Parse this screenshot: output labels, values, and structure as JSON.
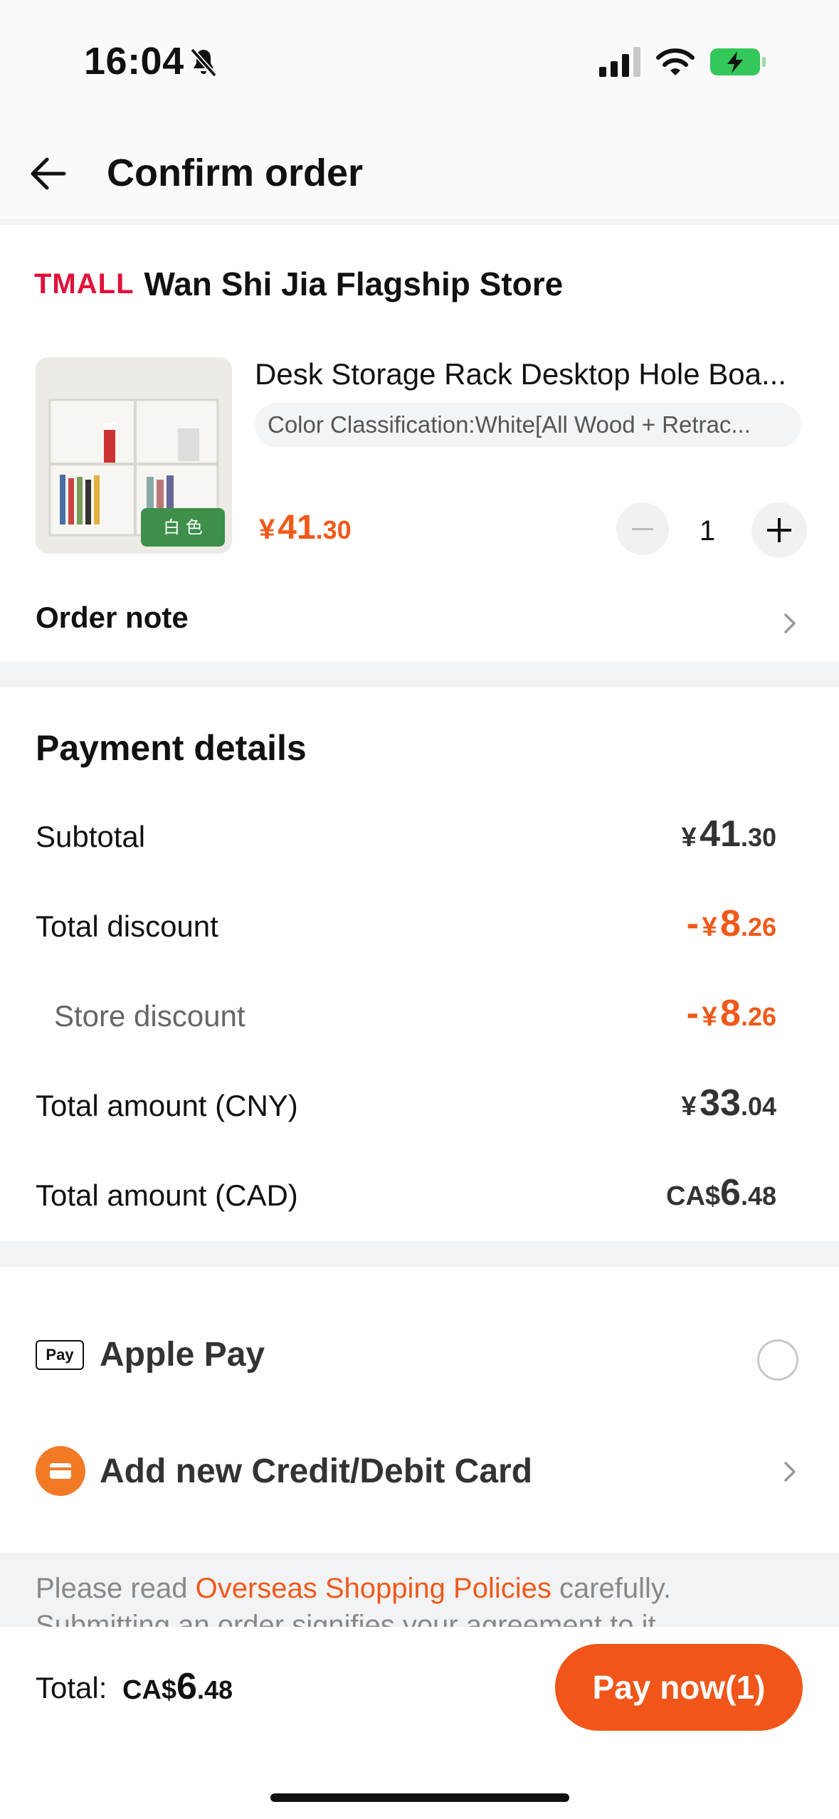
{
  "status_bar": {
    "time": "16:04",
    "icons": [
      "bell-slash-icon",
      "cellular-signal-icon",
      "wifi-icon",
      "battery-charging-icon"
    ]
  },
  "header": {
    "title": "Confirm order",
    "back_icon": "arrow-left-icon"
  },
  "store": {
    "logo_text": "TMALL",
    "name": "Wan Shi Jia Flagship Store",
    "product": {
      "title": "Desk Storage Rack Desktop Hole Boa...",
      "sku": "Color Classification:White[All Wood + Retrac...",
      "image_badge": "白 色",
      "price_symbol": "¥",
      "price_int": "41",
      "price_dec": ".30",
      "quantity": "1"
    },
    "note_label": "Order note"
  },
  "payment_details": {
    "title": "Payment details",
    "subtotal_label": "Subtotal",
    "subtotal_sym": "¥",
    "subtotal_int": "41",
    "subtotal_dec": ".30",
    "discount_label": "Total discount",
    "discount_sign": "-",
    "discount_sym": "¥",
    "discount_int": "8",
    "discount_dec": ".26",
    "store_discount_label": "Store discount",
    "store_discount_sign": "-",
    "store_discount_sym": "¥",
    "store_discount_int": "8",
    "store_discount_dec": ".26",
    "cny_label": "Total amount (CNY)",
    "cny_sym": "¥",
    "cny_int": "33",
    "cny_dec": ".04",
    "cad_label": "Total amount (CAD)",
    "cad_sym": "CA$",
    "cad_int": "6",
    "cad_dec": ".48"
  },
  "payment_methods": {
    "applepay_mark": "Pay",
    "applepay_label": "Apple Pay",
    "add_card_label": "Add new Credit/Debit Card"
  },
  "notice": {
    "prefix": "Please read ",
    "link": "Overseas Shopping Policies",
    "suffix": " carefully.",
    "line2": "Submitting an order signifies your agreement to it"
  },
  "bottom_bar": {
    "total_label": "Total:",
    "total_sym": "CA$",
    "total_int": "6",
    "total_dec": ".48",
    "pay_button": "Pay now(1)"
  },
  "colors": {
    "accent": "#f0591a",
    "tmall_red": "#e0103a",
    "background": "#f2f3f5"
  }
}
